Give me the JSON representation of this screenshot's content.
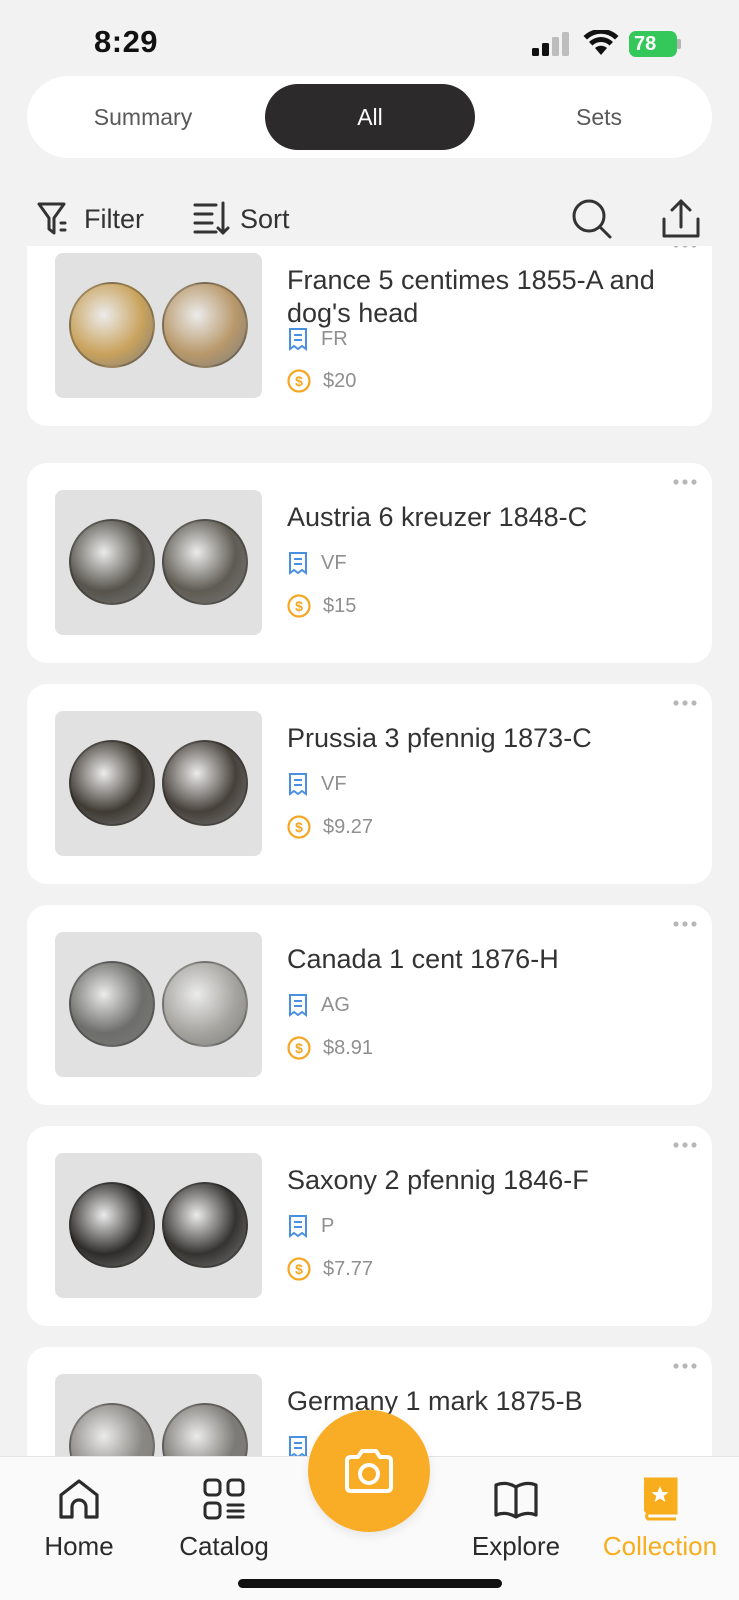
{
  "status": {
    "time": "8:29",
    "battery": "78"
  },
  "segments": {
    "summary": "Summary",
    "all": "All",
    "sets": "Sets"
  },
  "toolbar": {
    "filter_label": "Filter",
    "sort_label": "Sort",
    "search_icon": "search-icon",
    "share_icon": "share-icon"
  },
  "items": [
    {
      "title": "France 5 centimes 1855-A and dog's head",
      "grade": "FR",
      "price": "$20",
      "coin_color_a": "#c9a25c",
      "coin_color_b": "#b8986a"
    },
    {
      "title": "Austria 6 kreuzer 1848-C",
      "grade": "VF",
      "price": "$15",
      "coin_color_a": "#55534b",
      "coin_color_b": "#5e5b52"
    },
    {
      "title": "Prussia 3 pfennig 1873-C",
      "grade": "VF",
      "price": "$9.27",
      "coin_color_a": "#3f3a33",
      "coin_color_b": "#46403a"
    },
    {
      "title": "Canada 1 cent 1876-H",
      "grade": "AG",
      "price": "$8.91",
      "coin_color_a": "#6d6e6a",
      "coin_color_b": "#a5a49f"
    },
    {
      "title": "Saxony 2 pfennig 1846-F",
      "grade": "P",
      "price": "$7.77",
      "coin_color_a": "#2e2c2a",
      "coin_color_b": "#353330"
    },
    {
      "title": "Germany 1 mark 1875-B",
      "grade": "",
      "price": "",
      "coin_color_a": "#8a8883",
      "coin_color_b": "#7c7a75"
    }
  ],
  "tabs": {
    "home": "Home",
    "catalog": "Catalog",
    "explore": "Explore",
    "collection": "Collection"
  },
  "colors": {
    "accent": "#f7ad1c",
    "grade_icon": "#4a90e2",
    "price_icon": "#f5a623",
    "segment_active": "#2c2a2a"
  }
}
